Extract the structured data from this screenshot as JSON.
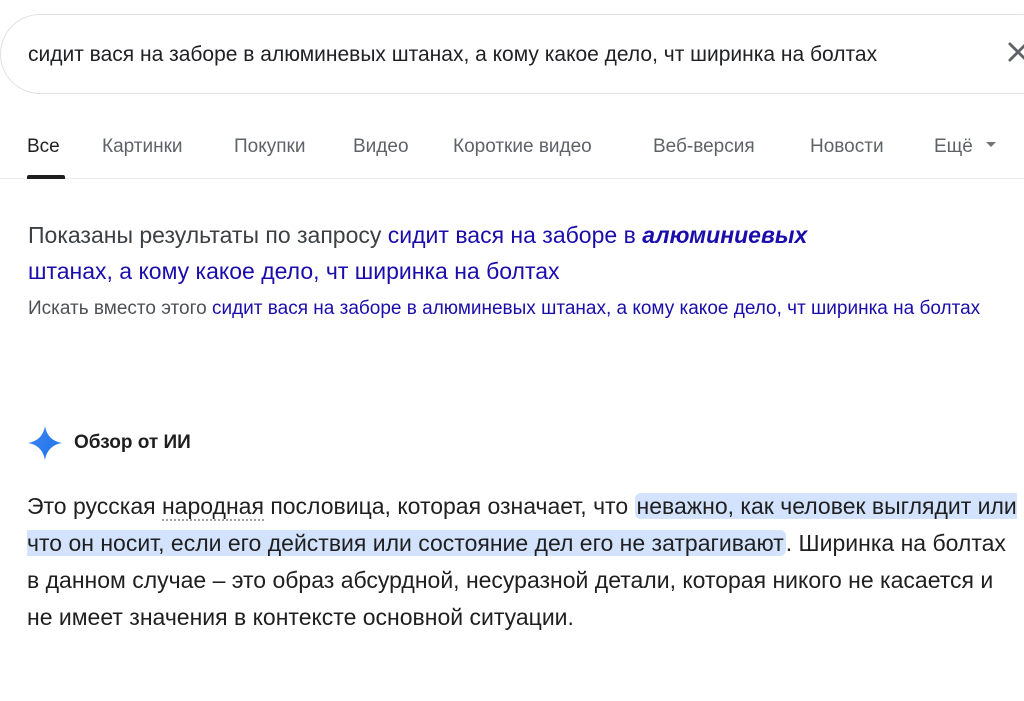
{
  "search": {
    "query": "сидит вася на заборе в алюминевых штанах, а кому какое дело, чт ширинка на болтах"
  },
  "tabs": [
    {
      "label": "Все",
      "active": true
    },
    {
      "label": "Картинки"
    },
    {
      "label": "Покупки"
    },
    {
      "label": "Видео"
    },
    {
      "label": "Короткие видео"
    },
    {
      "label": "Веб-версия"
    },
    {
      "label": "Новости"
    },
    {
      "label": "Ещё"
    }
  ],
  "spelling": {
    "prefix": "Показаны результаты по запросу",
    "corrected_part1": "сидит вася на заборе в",
    "corrected_bold": "алюминиевых",
    "corrected_part2": "штанах, а кому какое дело, чт ширинка на болтах",
    "instead_prefix": "Искать вместо этого",
    "instead_query": "сидит вася на заборе в алюминевых штанах, а кому какое дело, чт ширинка на болтах"
  },
  "ai_overview": {
    "title": "Обзор от ИИ",
    "text_start": "Это русская",
    "text_dotted": "народная",
    "text_mid": "пословица, которая означает, что",
    "text_highlight": "неважно, как человек выглядит или что он носит, если его действия или состояние дел его не затрагивают",
    "text_end": ". Ширинка на болтах в данном случае – это образ абсурдной, несуразной детали, которая никого не касается и не имеет значения в контексте основной ситуации."
  },
  "colors": {
    "link": "#1a0dab",
    "highlight": "#d3e3fd",
    "sparkle": "#4285f4"
  }
}
